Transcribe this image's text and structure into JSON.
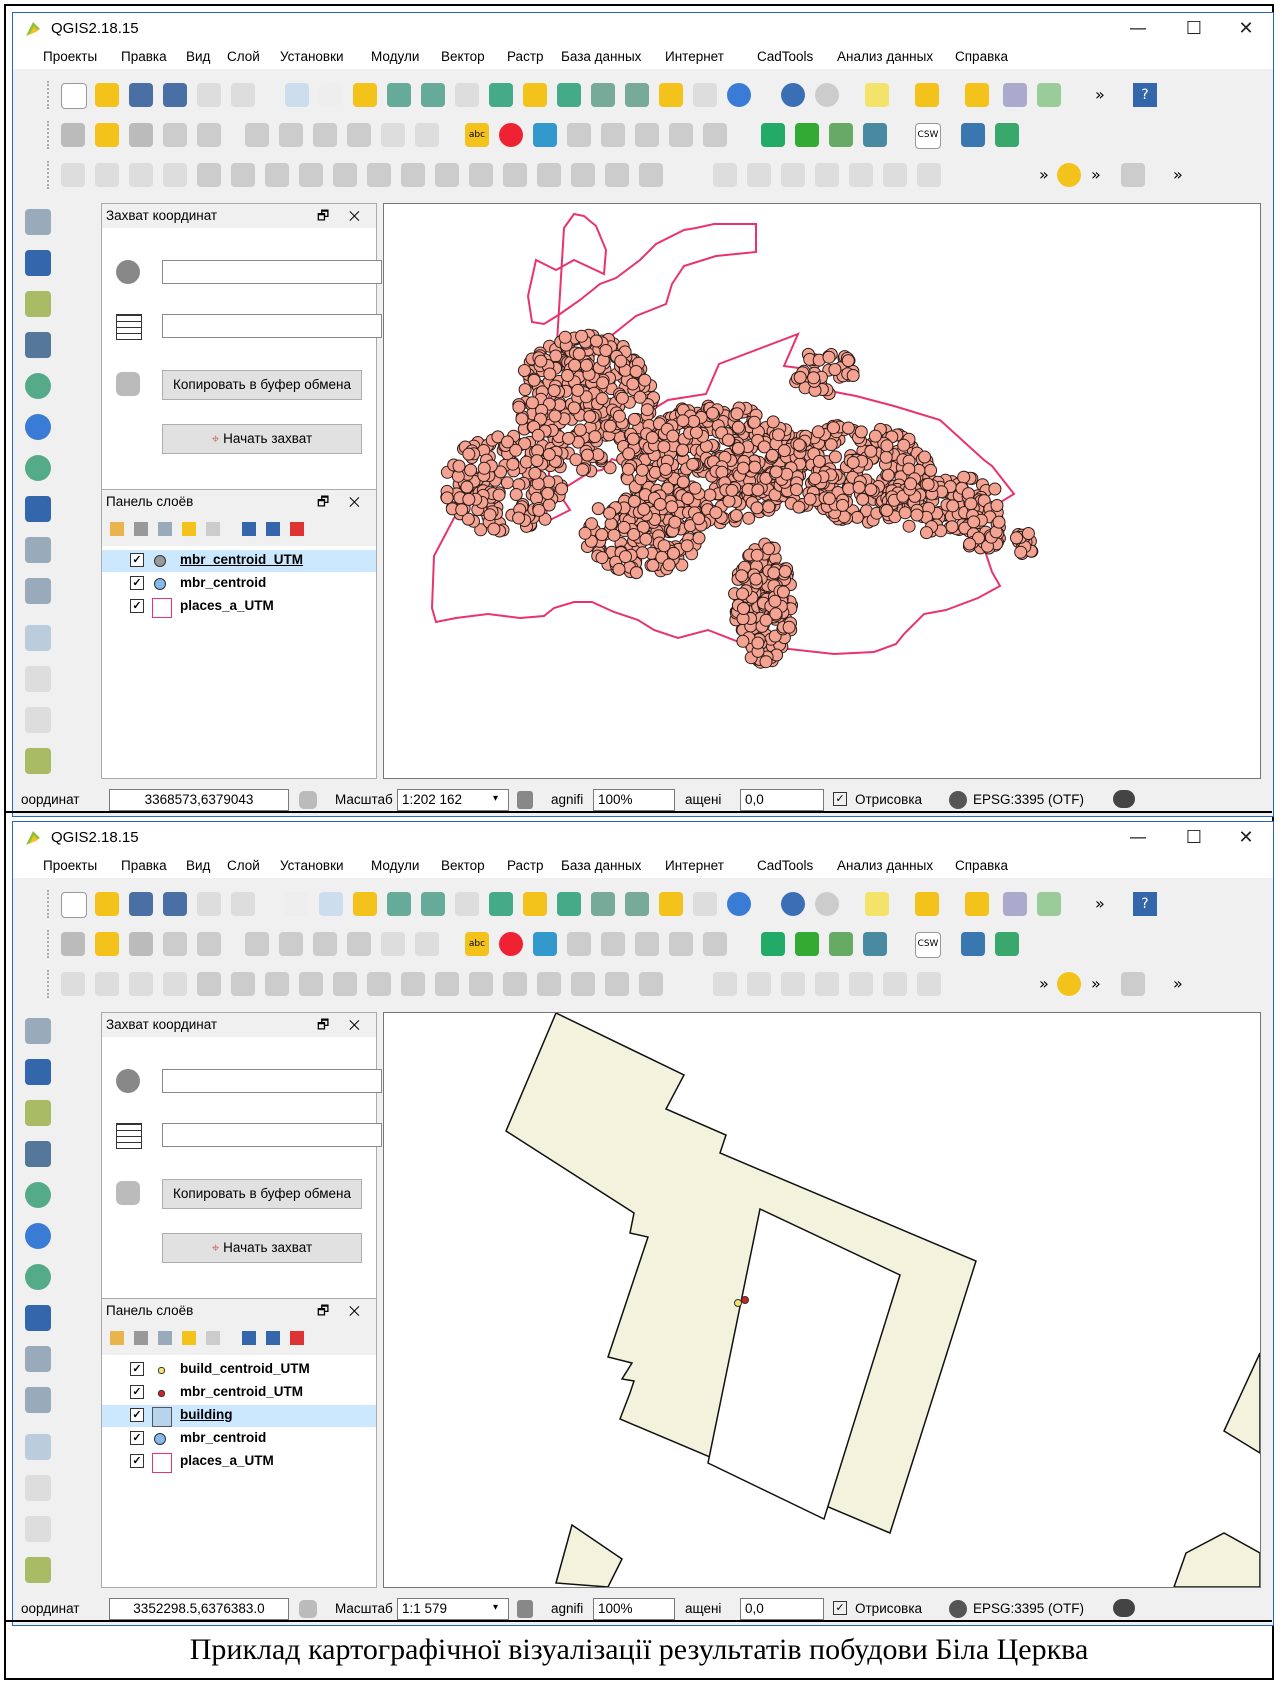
{
  "window": {
    "title": "QGIS2.18.15",
    "minimize": "—",
    "maximize": "☐",
    "close": "✕"
  },
  "menu": [
    "Проекты",
    "Правка",
    "Вид",
    "Слой",
    "Установки",
    "Модули",
    "Вектор",
    "Растр",
    "База данных",
    "Интернет",
    "CadTools",
    "Анализ данных",
    "Справка"
  ],
  "toolbar": {
    "overflow": "»",
    "help": "?",
    "csw": "CSW",
    "label_abc": "abc"
  },
  "capture_panel": {
    "title": "Захват координат",
    "copy_button": "Копировать в буфер обмена",
    "start_button": "Начать захват",
    "field1_value": "",
    "field2_value": ""
  },
  "layers_panel": {
    "title": "Панель слоёв"
  },
  "panel_buttons": "🗗 ✕",
  "screens": [
    {
      "layers": [
        {
          "name": "mbr_centroid_UTM",
          "checked": "✓",
          "selected": true
        },
        {
          "name": "mbr_centroid",
          "checked": "✓"
        },
        {
          "name": "places_a_UTM",
          "checked": "✓"
        }
      ],
      "status": {
        "coord_label": "оординат",
        "coord_value": "3368573,6379043",
        "scale_label": "Масштаб",
        "scale_value": "1:202 162",
        "magnifier_label": "agnifi",
        "magnifier_value": "100%",
        "rotation_label": "ащені",
        "rotation_value": "0,0",
        "render_label": "Отрисовка",
        "crs": "EPSG:3395 (OTF)"
      }
    },
    {
      "layers": [
        {
          "name": "build_centroid_UTM",
          "checked": "✓"
        },
        {
          "name": "mbr_centroid_UTM",
          "checked": "✓"
        },
        {
          "name": "building",
          "checked": "✓",
          "selected": true
        },
        {
          "name": "mbr_centroid",
          "checked": "✓"
        },
        {
          "name": "places_a_UTM",
          "checked": "✓"
        }
      ],
      "status": {
        "coord_label": "оординат",
        "coord_value": "3352298.5,6376383.0",
        "scale_label": "Масштаб",
        "scale_value": "1:1 579",
        "magnifier_label": "agnifi",
        "magnifier_value": "100%",
        "rotation_label": "ащені",
        "rotation_value": "0,0",
        "render_label": "Отрисовка",
        "crs": "EPSG:3395 (OTF)"
      }
    }
  ],
  "caption": "Приклад картографічної візуалізації результатів побудови Біла Церква",
  "colors": {
    "boundary": "#e8336e",
    "points": "#f4a393",
    "building_fill": "#f2f2dd",
    "selection": "#cce8ff"
  }
}
